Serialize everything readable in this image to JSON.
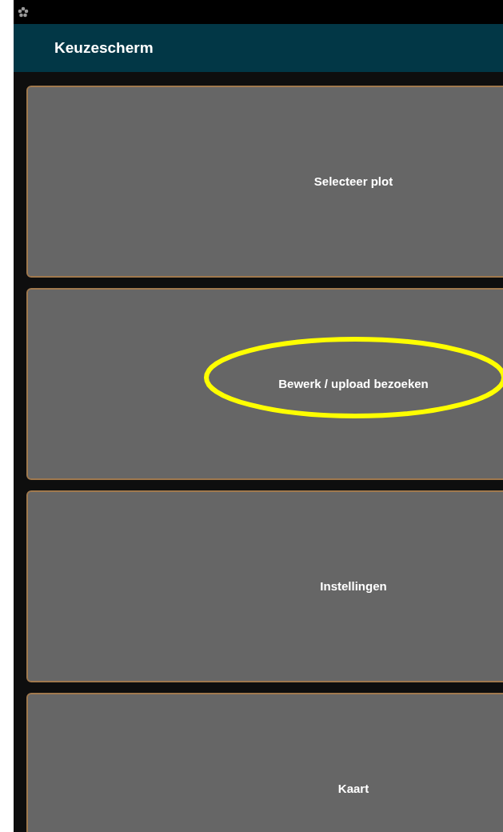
{
  "app_bar": {
    "title": "Keuzescherm"
  },
  "menu": [
    {
      "label": "Selecteer plot",
      "highlighted": false
    },
    {
      "label": "Bewerk / upload bezoeken",
      "highlighted": true
    },
    {
      "label": "Instellingen",
      "highlighted": false
    },
    {
      "label": "Kaart",
      "highlighted": false
    }
  ]
}
